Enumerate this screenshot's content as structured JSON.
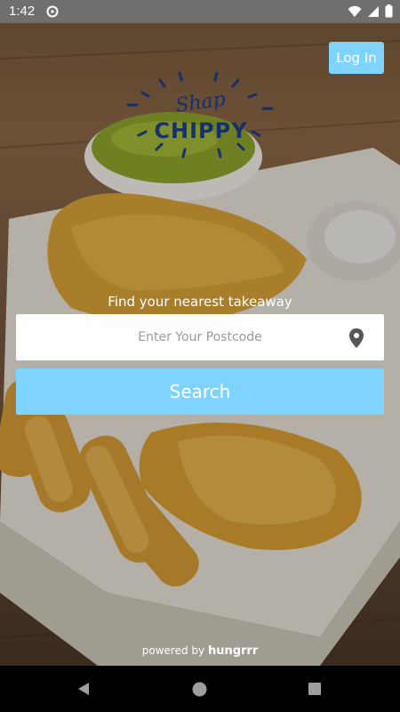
{
  "status_bar": {
    "time": "1:42",
    "icons": [
      "assistant-icon",
      "wifi-icon",
      "signal-icon",
      "battery-icon"
    ]
  },
  "header": {
    "login_label": "Log In"
  },
  "logo": {
    "line1": "Shap",
    "line2": "CHIPPY"
  },
  "search": {
    "tagline": "Find your nearest takeaway",
    "placeholder": "Enter Your Postcode",
    "value": "",
    "button_label": "Search"
  },
  "footer": {
    "powered_prefix": "powered by",
    "powered_brand": "hungrrr"
  },
  "nav_bar": {
    "buttons": [
      "back-icon",
      "home-icon",
      "recents-icon"
    ]
  },
  "colors": {
    "accent": "#7fd3ff",
    "logo_blue": "#17306b",
    "status_bar": "#6f6f6f"
  }
}
